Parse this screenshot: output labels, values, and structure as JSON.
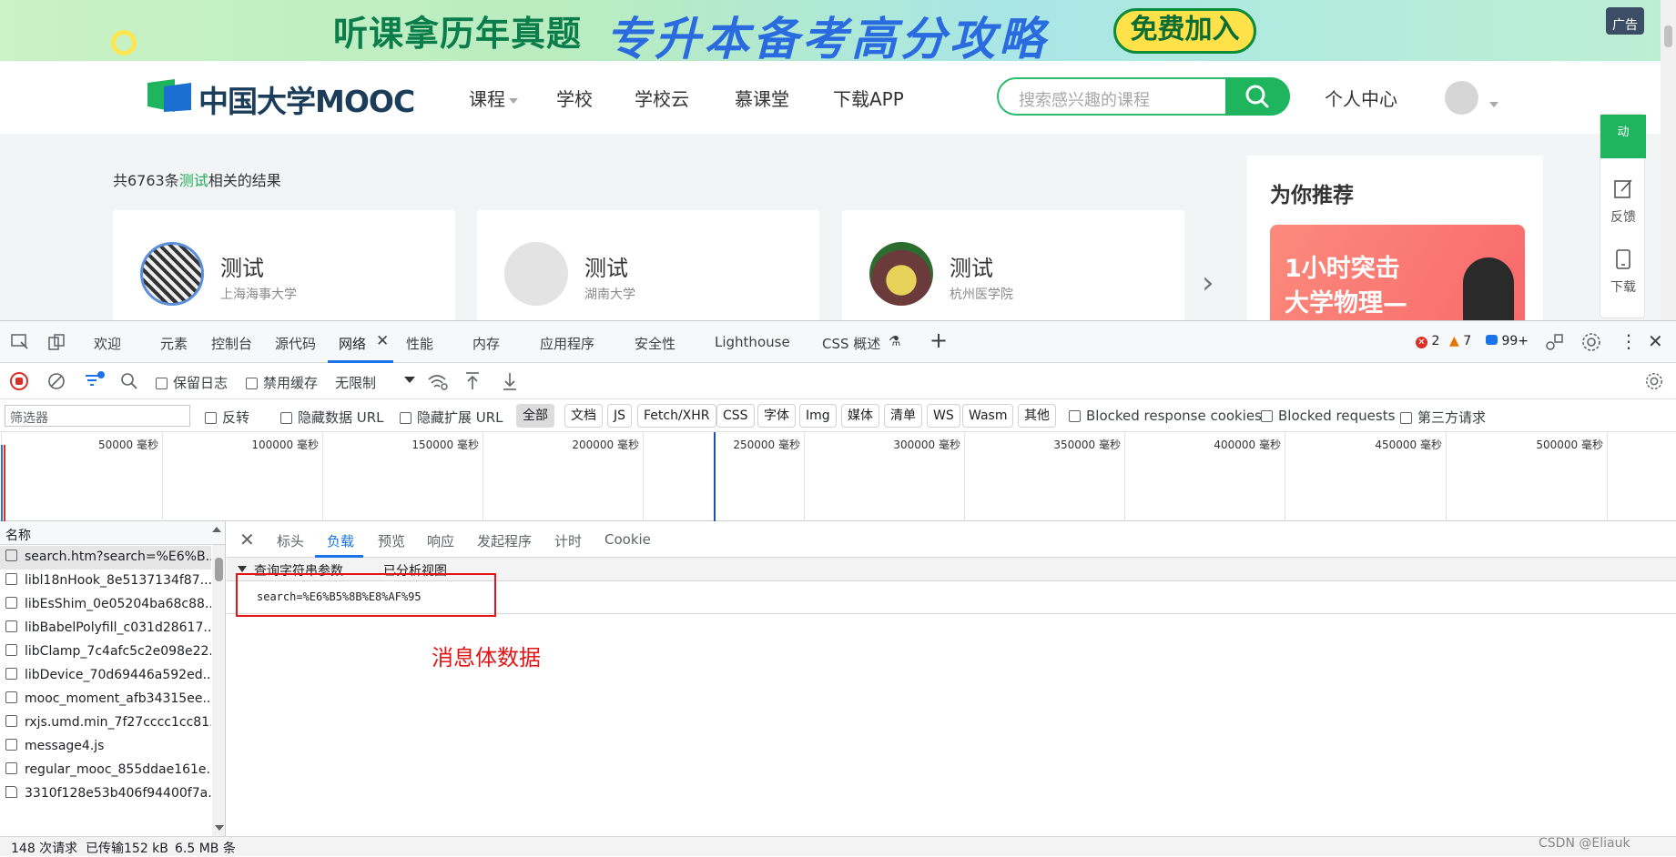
{
  "ad": {
    "left_text": "听课拿历年真题",
    "main_text": "专升本备考高分攻略",
    "join_button": "免费加入",
    "tag": "广告"
  },
  "header": {
    "logo": "中国大学MOOC",
    "nav": [
      "课程",
      "学校",
      "学校云",
      "慕课堂",
      "下载APP"
    ],
    "search_placeholder": "搜索感兴趣的课程",
    "user_center": "个人中心"
  },
  "results": {
    "count_prefix": "共6763条",
    "keyword": "测试",
    "count_suffix": "相关的结果",
    "cards": [
      {
        "title": "测试",
        "school": "上海海事大学"
      },
      {
        "title": "测试",
        "school": "湖南大学"
      },
      {
        "title": "测试",
        "school": "杭州医学院"
      }
    ],
    "recommend_title": "为你推荐",
    "recommend_line1": "1小时突击",
    "recommend_line2": "大学物理—"
  },
  "side_bar": {
    "top_label": "动",
    "feedback": "反馈",
    "download": "下载"
  },
  "devtools": {
    "tabs": [
      "欢迎",
      "元素",
      "控制台",
      "源代码",
      "网络",
      "性能",
      "内存",
      "应用程序",
      "安全性",
      "Lighthouse",
      "CSS 概述"
    ],
    "errors": "2",
    "warnings": "7",
    "messages": "99+",
    "toolbar": {
      "preserve_log": "保留日志",
      "disable_cache": "禁用缓存",
      "throttle": "无限制"
    },
    "filter_bar": {
      "filter_placeholder": "筛选器",
      "invert": "反转",
      "hide_data_url": "隐藏数据 URL",
      "hide_ext_url": "隐藏扩展 URL",
      "types": [
        "全部",
        "文档",
        "JS",
        "Fetch/XHR",
        "CSS",
        "字体",
        "Img",
        "媒体",
        "清单",
        "WS",
        "Wasm",
        "其他"
      ],
      "blocked_cookies": "Blocked response cookies",
      "blocked_requests": "Blocked requests",
      "third_party": "第三方请求"
    },
    "timeline_ticks": [
      "50000 毫秒",
      "100000 毫秒",
      "150000 毫秒",
      "200000 毫秒",
      "250000 毫秒",
      "300000 毫秒",
      "350000 毫秒",
      "400000 毫秒",
      "450000 毫秒",
      "500000 毫秒"
    ],
    "request_list": {
      "header": "名称",
      "items": [
        "search.htm?search=%E6%B...",
        "libl18nHook_8e5137134f87...",
        "libEsShim_0e05204ba68c88...",
        "libBabelPolyfill_c031d28617...",
        "libClamp_7c4afc5c2e098e22...",
        "libDevice_70d69446a592ed...",
        "mooc_moment_afb34315ee...",
        "rxjs.umd.min_7f27cccc1cc81...",
        "message4.js",
        "regular_mooc_855ddae161e...",
        "3310f128e53b406f94400f7a..."
      ]
    },
    "detail": {
      "tabs": [
        "标头",
        "负载",
        "预览",
        "响应",
        "发起程序",
        "计时",
        "Cookie"
      ],
      "section": "查询字符串参数",
      "parsed_view": "已分析视图",
      "query": "search=%E6%B5%8B%E8%AF%95",
      "annotation": "消息体数据"
    },
    "status": {
      "requests": "148 次请求",
      "transferred": "已传输152 kB",
      "resources": "6.5 MB 条"
    },
    "watermark": "CSDN @Eliauk  "
  }
}
